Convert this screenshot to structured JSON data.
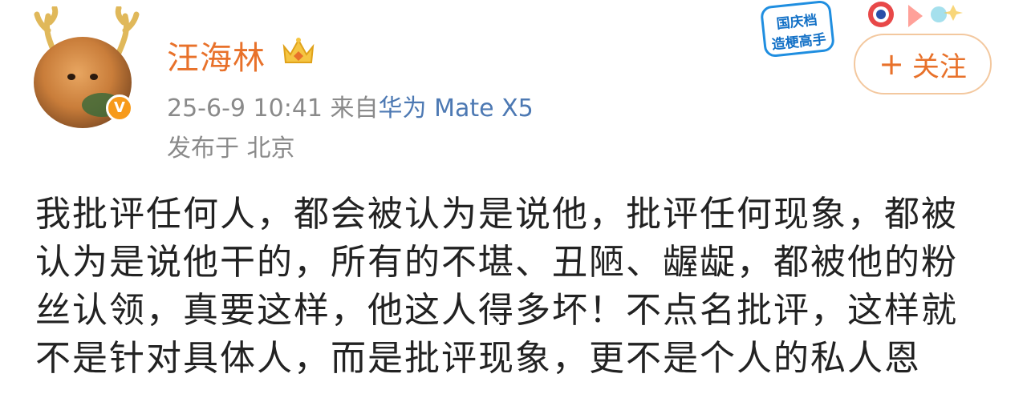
{
  "user": {
    "name": "汪海林",
    "verified_badge": "V"
  },
  "meta": {
    "datetime": "25-6-9 10:41",
    "from_label": "来自",
    "device": "华为 Mate X5",
    "location": "发布于 北京"
  },
  "promo": {
    "line1": "国庆档",
    "line2": "造梗高手"
  },
  "follow_button": {
    "plus": "+",
    "label": "关注"
  },
  "post": {
    "lines": [
      "我批评任何人，都会被认为是说他，批评任何现象，都被",
      "认为是说他干的，所有的不堪、丑陋、龌龊，都被他的粉",
      "丝认领，真要这样，他这人得多坏！不点名批评，这样就",
      "不是针对具体人，而是批评现象，更不是个人的私人恩"
    ]
  },
  "colors": {
    "username": "#e8712a",
    "meta": "#8a8a8a",
    "device_link": "#4d79b3",
    "verified": "#f79a1a",
    "follow_border": "#f3c89f",
    "body_text": "#222222"
  }
}
